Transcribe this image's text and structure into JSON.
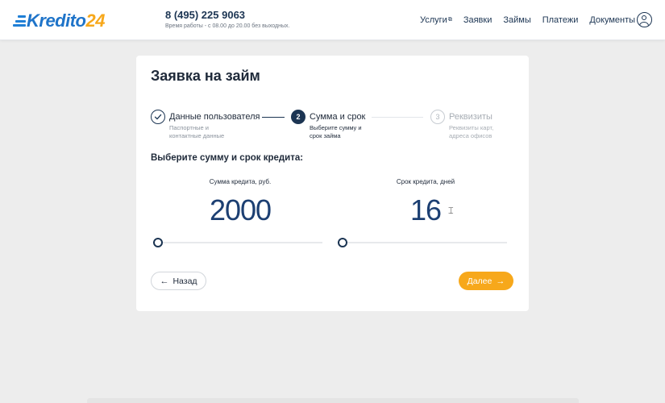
{
  "header": {
    "logo": {
      "part1": "Kredito",
      "part2": "24"
    },
    "phone": "8 (495) 225 9063",
    "hours": "Время работы - с 08.00 до 20.00 без выходных.",
    "nav": [
      {
        "label": "Услуги",
        "external": true
      },
      {
        "label": "Заявки"
      },
      {
        "label": "Займы"
      },
      {
        "label": "Платежи"
      },
      {
        "label": "Документы"
      }
    ],
    "user_icon": "user-circle-icon"
  },
  "form": {
    "title": "Заявка на займ",
    "steps": [
      {
        "number": "1",
        "label": "Данные пользователя",
        "sub": [
          "Паспортные и",
          "контактные данные"
        ],
        "state": "done"
      },
      {
        "number": "2",
        "label": "Сумма и срок",
        "sub": [
          "Выберите сумму и",
          "срок займа"
        ],
        "state": "active"
      },
      {
        "number": "3",
        "label": "Реквизиты",
        "sub": [
          "Реквизиты карт,",
          "адреса офисов"
        ],
        "state": "pending"
      }
    ],
    "subtitle": "Выберите сумму и срок кредита:",
    "amount": {
      "label": "Сумма кредита, руб.",
      "value": "2000",
      "slider_fraction": 0.0
    },
    "term": {
      "label": "Срок кредита, дней",
      "value": "16",
      "slider_fraction": 0.0
    },
    "back_button": "Назад",
    "next_button": "Далее"
  },
  "colors": {
    "brand_blue": "#1f74c9",
    "brand_orange": "#f7a81b",
    "dark_navy": "#1c3553",
    "value_blue": "#1c3f72"
  }
}
